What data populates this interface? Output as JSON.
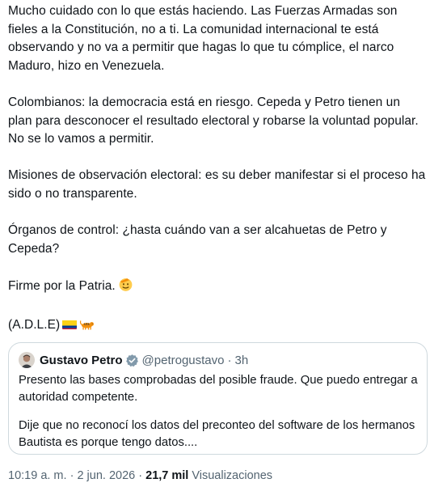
{
  "tweet": {
    "paragraphs": [
      "Mucho cuidado con lo que estás haciendo. Las Fuerzas Armadas son fieles a la Constitución, no a ti. La comunidad internacional te está observando y no va a permitir que hagas lo que tu cómplice, el narco Maduro, hizo en Venezuela.",
      "Colombianos: la democracia está en riesgo. Cepeda y Petro tienen un plan para desconocer el resultado electoral y robarse la voluntad popular. No se lo vamos a permitir.",
      "Misiones de observación electoral: es su deber manifestar si el proceso ha sido o no transparente.",
      "Órganos de control: ¿hasta cuándo van a ser alcahuetas de Petro y Cepeda?"
    ],
    "closing": "Firme por la Patria.",
    "signature": "(A.D.L.E)",
    "icons": [
      "saluting-face-icon",
      "colombia-flag-icon",
      "tiger-icon"
    ]
  },
  "quote": {
    "author_name": "Gustavo Petro",
    "handle": "@petrogustavo",
    "separator": "·",
    "time": "3h",
    "paragraphs": [
      "Presento las bases  comprobadas del posible fraude. Que puedo entregar a autoridad competente.",
      "Dije que no reconocí los datos del preconteo del software de los hermanos Bautista es porque tengo datos...."
    ],
    "verified_color": "#829aab"
  },
  "footer": {
    "time": "10:19 a. m.",
    "separator": "·",
    "date": "2 jun. 2026",
    "views_count": "21,7 mil",
    "views_label": "Visualizaciones"
  },
  "colors": {
    "text": "#0f1419",
    "secondary": "#536471",
    "border": "#cfd9de"
  }
}
